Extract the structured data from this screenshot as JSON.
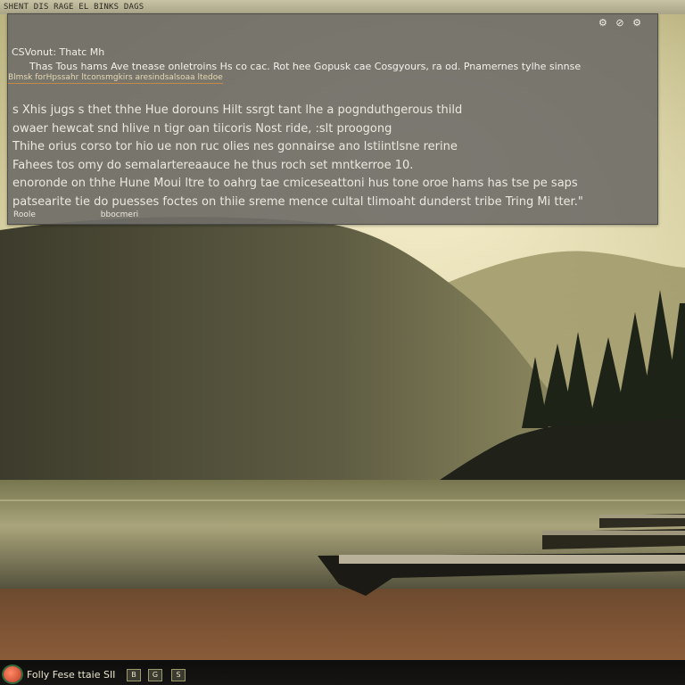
{
  "window": {
    "title": "SHENT DIS RAGE EL BINKS DAGS"
  },
  "panel": {
    "header_icons": [
      "⚙",
      "⊘",
      "⚙"
    ],
    "label": "CSVonut: Thatc Mh",
    "line1": "Thas Tous hams Ave tnease onletroins Hs co cac. Rot hee Gopusk cae Cosgyours, ra od. Pnamernes tylhe sinnse",
    "line2": "Blmsk forHpssahr ltconsmgkirs aresindsalsoaa ltedoe",
    "body_lines": [
      "s Xhis jugs s thet thhe Hue dorouns Hilt ssrgt tant lhe a pognduthgerous thild",
      "owaer hewcat snd hlive n tigr oan tiicoris Nost ride,  :slt proogong",
      "Thihe orius corso tor hio ue non ruc olies nes gonnairse ano lstiintlsne rerine",
      "Fahees tos omy do semalartereaauce he thus roch set mntkerroe 10.",
      "enoronde on thhe Hune Moui ltre to oahrg tae cmiceseattoni hus tone oroe hams has tse pe saps",
      "patsearite tie do puesses foctes on thiie sreme mence cultal tlimoaht dunderst tribe Tring Mi tter.\""
    ],
    "footer": [
      "Roole",
      "bbocmeri"
    ]
  },
  "taskbar": {
    "label": "Folly Fese ttaie SII",
    "icons": [
      "B",
      "G",
      "S"
    ]
  }
}
